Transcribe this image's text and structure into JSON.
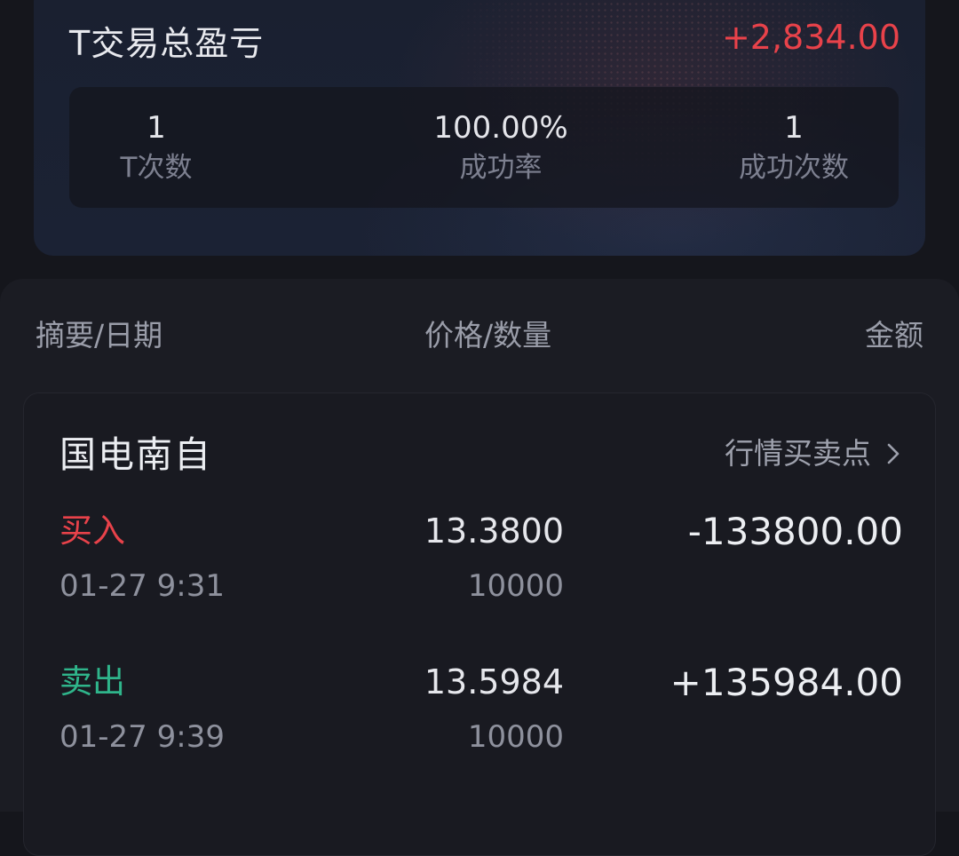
{
  "summary": {
    "title": "T交易总盈亏",
    "total": "+2,834.00",
    "total_color": "#e8424a",
    "stats": [
      {
        "value": "1",
        "label": "T次数"
      },
      {
        "value": "100.00%",
        "label": "成功率"
      },
      {
        "value": "1",
        "label": "成功次数"
      }
    ]
  },
  "table": {
    "headers": {
      "summary_date": "摘要/日期",
      "price_qty": "价格/数量",
      "amount": "金额"
    },
    "record": {
      "stock_name": "国电南自",
      "market_link_label": "行情买卖点",
      "market_link_icon": "chevron-right-icon",
      "trades": [
        {
          "side": "买入",
          "side_color": "#e8424a",
          "time": "01-27 9:31",
          "price": "13.3800",
          "quantity": "10000",
          "amount": "-133800.00"
        },
        {
          "side": "卖出",
          "side_color": "#2fb58b",
          "time": "01-27 9:39",
          "price": "13.5984",
          "quantity": "10000",
          "amount": "+135984.00"
        }
      ]
    }
  }
}
